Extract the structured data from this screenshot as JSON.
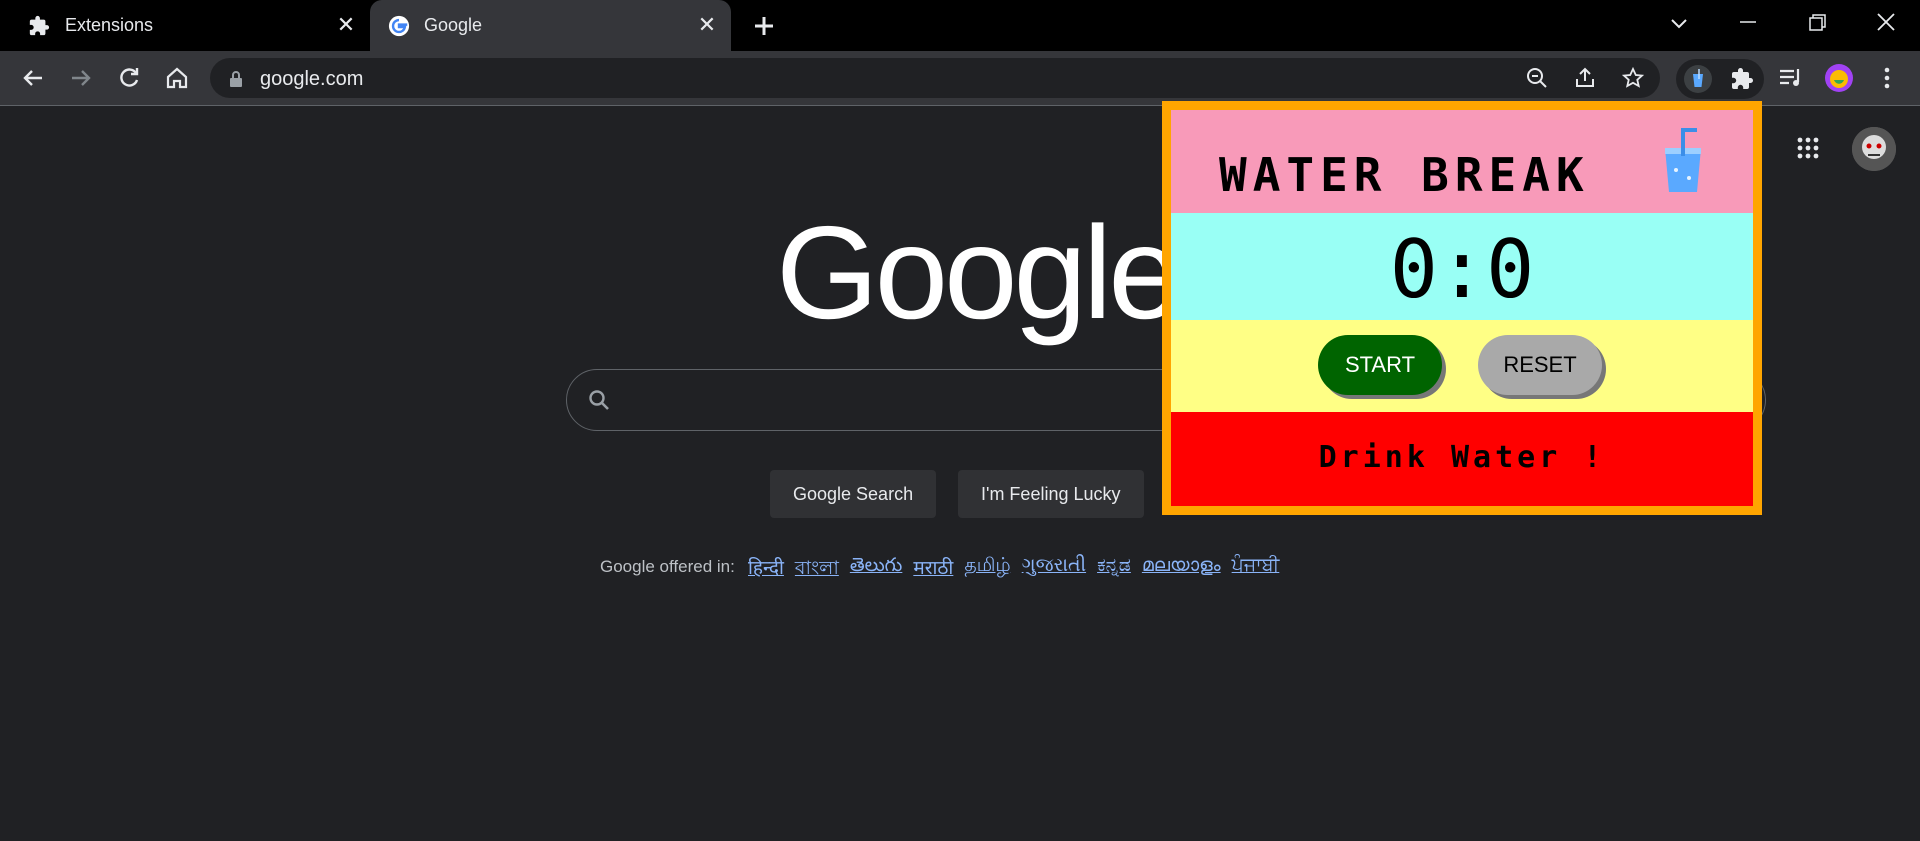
{
  "tabs": [
    {
      "label": "Extensions",
      "icon": "puzzle-icon"
    },
    {
      "label": "Google",
      "icon": "google-g-icon"
    }
  ],
  "toolbar": {
    "url": "google.com",
    "icons": [
      "back-icon",
      "forward-icon",
      "reload-icon",
      "home-icon",
      "lock-icon",
      "zoom-out-icon",
      "share-icon",
      "star-icon",
      "water-extension-icon",
      "extensions-puzzle-icon",
      "media-icon",
      "profile-icon",
      "menu-icon"
    ]
  },
  "google": {
    "logo": "Google",
    "search_button": "Google Search",
    "lucky_button": "I'm Feeling Lucky",
    "offered_in": "Google offered in:",
    "languages": [
      "हिन्दी",
      "বাংলা",
      "తెలుగు",
      "मराठी",
      "தமிழ்",
      "ગુજરાતી",
      "ಕನ್ನಡ",
      "മലയാളം",
      "ਪੰਜਾਬੀ"
    ]
  },
  "popup": {
    "title": "WATER BREAK",
    "timer": "0:0",
    "start": "START",
    "reset": "RESET",
    "message": "Drink Water !"
  },
  "colors": {
    "popup_border": "#ffa500",
    "title_bg": "#f89ab9",
    "timer_bg": "#99fff5",
    "buttons_bg": "#ffff85",
    "message_bg": "#ff0000",
    "start_bg": "#006400",
    "reset_bg": "#a9a9a9"
  }
}
